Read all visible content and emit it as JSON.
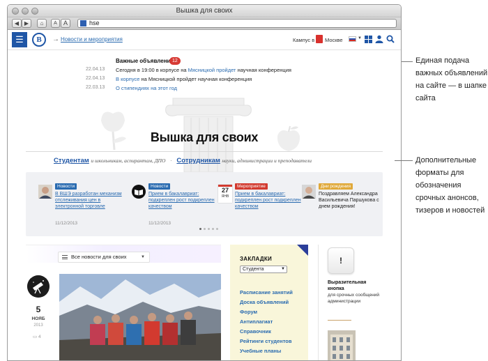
{
  "window": {
    "title": "Вышка для своих"
  },
  "toolbar": {
    "back": "◀",
    "forward": "▶",
    "home": "⌂",
    "font_small": "A",
    "font_large": "A",
    "address": "hse"
  },
  "header": {
    "breadcrumb": "Новости и мероприятия",
    "campus_label": "Кампус в",
    "campus_city": "Москве",
    "language": "ru"
  },
  "announcements": {
    "title": "Важные объявления",
    "count": "12",
    "items": [
      {
        "date": "22.04.13",
        "prefix": "Сегодня в 19:00 в корпусе на ",
        "link": "Мясницкой пройдет",
        "suffix": " научная конференция"
      },
      {
        "date": "22.04.13",
        "prefix": "",
        "link": "В корпусе",
        "suffix": " на Мясницкой пройдет научная конференция"
      },
      {
        "date": "22.03.13",
        "prefix": "",
        "link": "О стипендиях на этот год",
        "suffix": ""
      }
    ]
  },
  "hero": {
    "title": "Вышка для своих"
  },
  "audience": {
    "students_link": "Студентам",
    "students_note": "и школьникам, аспирантам, ДПО",
    "staff_link": "Сотрудникам",
    "staff_note": "науки, администрации и преподаватели",
    "separator": "·"
  },
  "news": [
    {
      "tag": "Новости",
      "tag_color": "#2a6bb0",
      "text": "В ВШЭ разработан механизм отслеживания цен в электронной торговле",
      "date": "11/12/2013",
      "pic": "person-photo"
    },
    {
      "tag": "Новости",
      "tag_color": "#2a6bb0",
      "text": "Прием в бакалавриат: подкреплен рост подкреплен качеством",
      "date": "11/12/2013",
      "pic": "book-icon"
    },
    {
      "tag": "Мероприятие",
      "tag_color": "#d23a2f",
      "text": "Прием в бакалавриат: подкреплен рост подкреплен качеством",
      "date": "",
      "pic": "calendar-icon",
      "cal_day": "27",
      "cal_month": "ЯНВ"
    },
    {
      "tag": "Дни рождения",
      "tag_color": "#e0a93a",
      "text": "Поздравляем Александра Васильевича Паршукова с днем рождения!",
      "date": "",
      "pic": "person-photo"
    }
  ],
  "feed": {
    "select_label": "Все новости для своих",
    "event_day": "5",
    "event_month": "НОЯБ",
    "event_year": "2013",
    "comments": "4"
  },
  "bookmarks": {
    "title": "ЗАКЛАДКИ",
    "audience_select": "Студента",
    "links": [
      "Расписание занятий",
      "Доска объявлений",
      "Форум",
      "Антиплагиат",
      "Справочник",
      "Рейтинги студентов",
      "Учебные планы"
    ]
  },
  "urgent": {
    "button": "!",
    "title": "Выразительная кнопка",
    "description": "для срочных сообщений администрации"
  },
  "callouts": {
    "top": "Единая подача важных объявлений на сайте — в шапке сайта",
    "bottom": "Дополнительные форматы для обозначения срочных анонсов, тизеров и новостей"
  },
  "colors": {
    "brand_blue": "#1f56a6",
    "link": "#2a6bb0",
    "accent_red": "#d73a34",
    "bookmarks_bg": "#f9f6da"
  }
}
